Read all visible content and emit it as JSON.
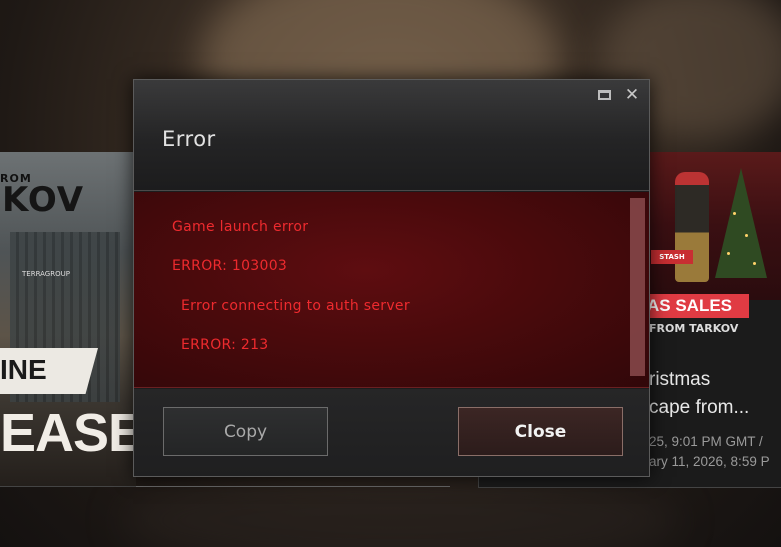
{
  "dialog": {
    "title": "Error",
    "maximize_icon": "maximize-icon",
    "close_icon": "close-icon",
    "close_glyph": "✕",
    "error_lines": [
      "Game launch error",
      "ERROR: 103003",
      "Error connecting to auth server",
      "ERROR: 213"
    ],
    "buttons": {
      "copy_label": "Copy",
      "close_label": "Close"
    },
    "colors": {
      "error_text": "#ee2a2e",
      "panel_bg": "#4a0a0c"
    }
  },
  "background": {
    "left_card": {
      "logo_small": "ROM",
      "logo_big": "KOV",
      "logo_sub": "TERRAGROUP",
      "ribbon_text": "INE",
      "headline": "EASE"
    },
    "right_card": {
      "image_badge": "STASH",
      "banner": "AS SALES",
      "small_logo": "FROM TARKOV",
      "title_lines": [
        "ristmas",
        "cape from..."
      ],
      "date_lines": [
        "25, 9:01 PM GMT /",
        "ary 11, 2026, 8:59 P"
      ],
      "accent_color": "#e03b43"
    }
  }
}
